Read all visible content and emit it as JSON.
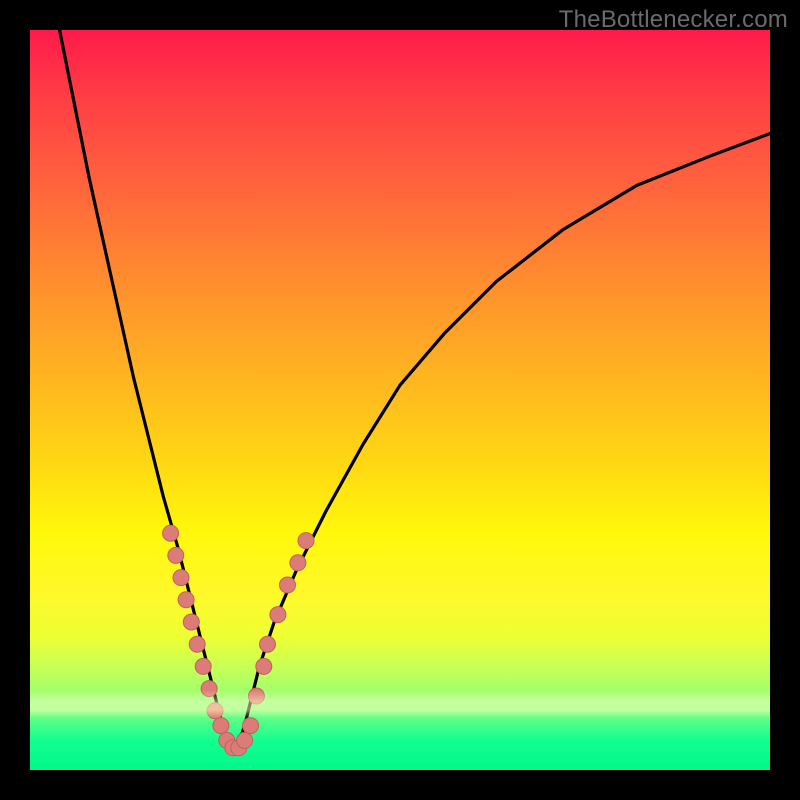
{
  "watermark": {
    "text": "TheBottlenecker.com"
  },
  "colors": {
    "background": "#000000",
    "gradient_top": "#ff1a4a",
    "gradient_mid": "#fff80a",
    "gradient_bottom": "#00f78a",
    "curve": "#000000",
    "marker_fill": "#dc7c78",
    "marker_stroke": "#c45f5b"
  },
  "chart_data": {
    "type": "line",
    "title": "",
    "xlabel": "",
    "ylabel": "",
    "xlim": [
      0,
      100
    ],
    "ylim": [
      0,
      100
    ],
    "notes": "V-shaped bottleneck curve; minimum ≈ x≈27. Markers cluster on both arms between y≈4 and y≈30.",
    "series": [
      {
        "name": "curve",
        "x": [
          4,
          6,
          8,
          10,
          12,
          14,
          16,
          18,
          20,
          22,
          23,
          24,
          25,
          26,
          27,
          28,
          29,
          30,
          31,
          33,
          36,
          40,
          45,
          50,
          56,
          63,
          72,
          82,
          92,
          100
        ],
        "y": [
          100,
          90,
          80,
          71,
          62,
          53,
          45,
          37,
          30,
          22,
          18,
          14,
          10,
          6,
          3,
          3,
          6,
          10,
          14,
          20,
          27,
          35,
          44,
          52,
          59,
          66,
          73,
          79,
          83,
          86
        ]
      }
    ],
    "markers": [
      {
        "x": 19.0,
        "y": 32
      },
      {
        "x": 19.7,
        "y": 29
      },
      {
        "x": 20.4,
        "y": 26
      },
      {
        "x": 21.1,
        "y": 23
      },
      {
        "x": 21.8,
        "y": 20
      },
      {
        "x": 22.6,
        "y": 17
      },
      {
        "x": 23.4,
        "y": 14
      },
      {
        "x": 24.2,
        "y": 11
      },
      {
        "x": 25.0,
        "y": 8
      },
      {
        "x": 25.8,
        "y": 6
      },
      {
        "x": 26.6,
        "y": 4
      },
      {
        "x": 27.4,
        "y": 3
      },
      {
        "x": 28.2,
        "y": 3
      },
      {
        "x": 29.0,
        "y": 4
      },
      {
        "x": 29.8,
        "y": 6
      },
      {
        "x": 30.6,
        "y": 10
      },
      {
        "x": 31.6,
        "y": 14
      },
      {
        "x": 32.1,
        "y": 17
      },
      {
        "x": 33.5,
        "y": 21
      },
      {
        "x": 34.8,
        "y": 25
      },
      {
        "x": 36.2,
        "y": 28
      },
      {
        "x": 37.3,
        "y": 31
      }
    ]
  }
}
